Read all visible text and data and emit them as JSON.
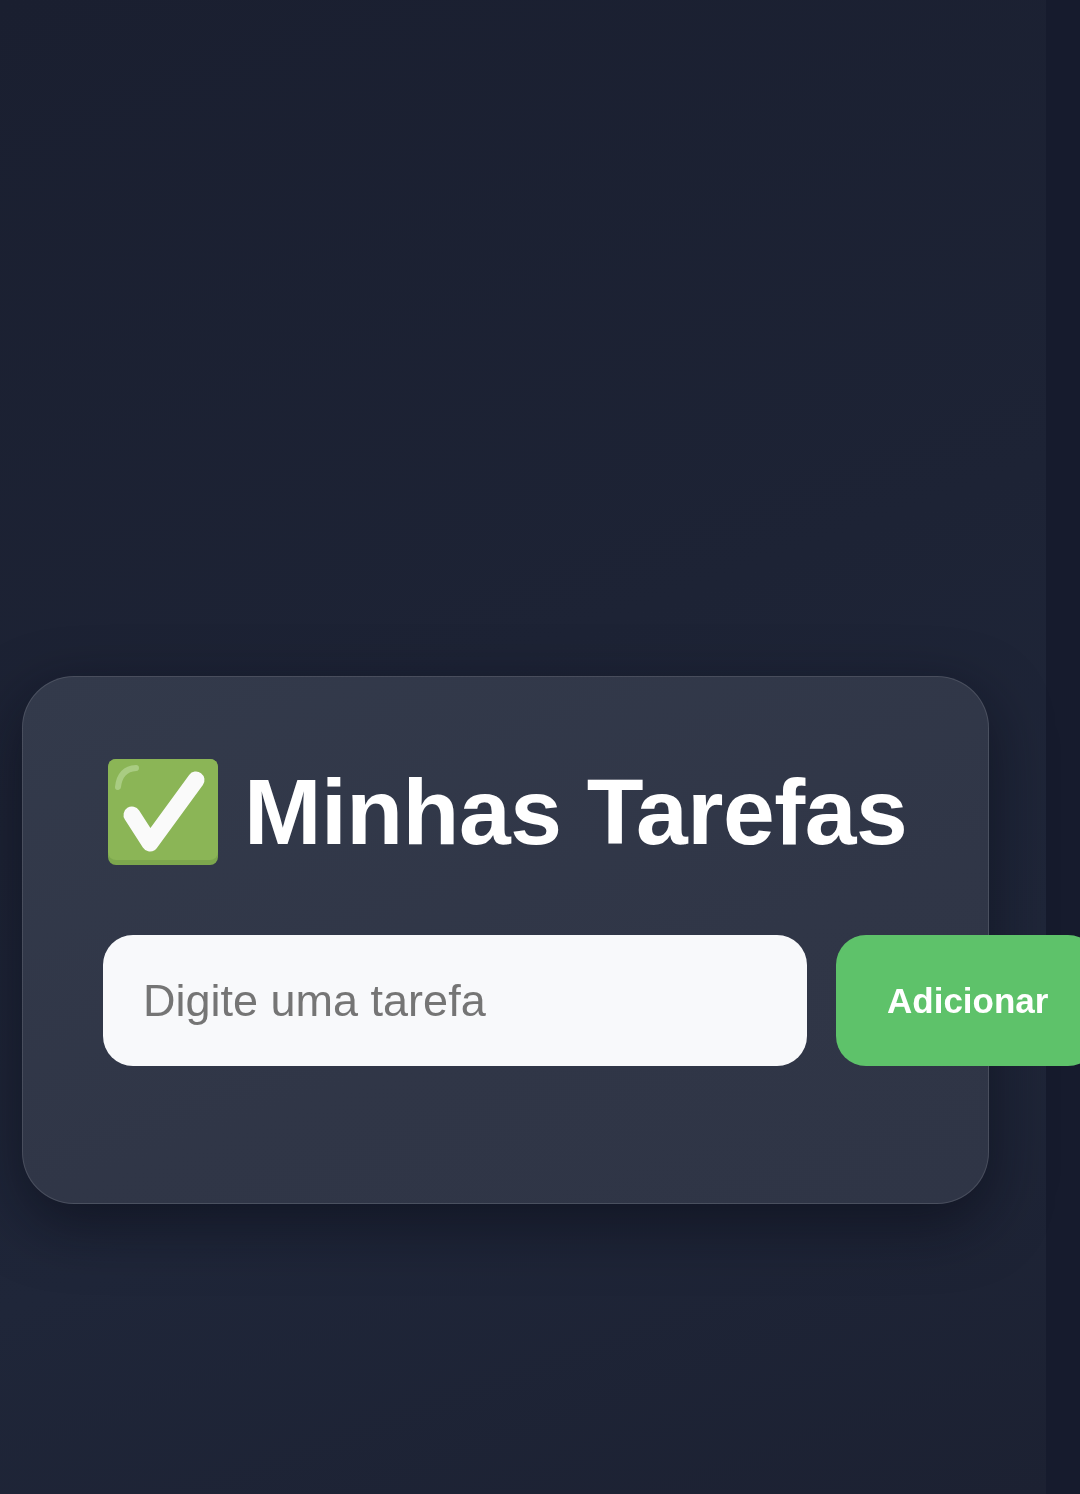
{
  "title": {
    "text": "Minhas Tarefas"
  },
  "task_input": {
    "placeholder": "Digite uma tarefa"
  },
  "add_button": {
    "label": "Adicionar"
  }
}
